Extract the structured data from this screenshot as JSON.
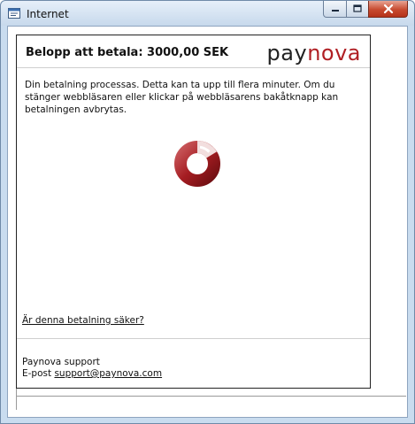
{
  "window": {
    "title": "Internet",
    "icons": {
      "app": "ie-page-icon",
      "minimize": "minimize-icon",
      "maximize": "maximize-icon",
      "close": "close-icon"
    }
  },
  "payment": {
    "amount_heading": "Belopp att betala: 3000,00 SEK",
    "logo_part1": "pay",
    "logo_part2": "nova",
    "message": "Din betalning processas. Detta kan ta upp till flera minuter. Om du stänger webbläsaren eller klickar på webbläsarens bakåtknapp kan betalningen avbrytas.",
    "safe_link": "Är denna betalning säker?"
  },
  "support": {
    "title": "Paynova support",
    "email_label": "E-post",
    "email": "support@paynova.com"
  },
  "colors": {
    "brand_red": "#b01f24",
    "brand_dark": "#222222"
  }
}
